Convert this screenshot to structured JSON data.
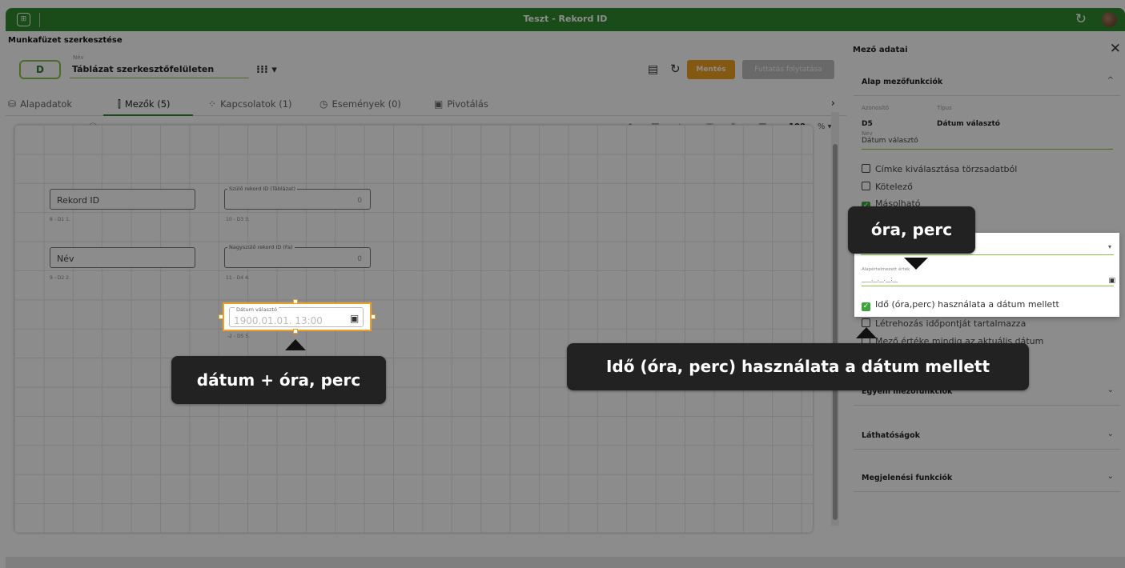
{
  "window": {
    "title": "Teszt - Rekord ID"
  },
  "header": {
    "page_title": "Munkafüzet szerkesztése",
    "badge": "D",
    "name_label": "Név",
    "name_value": "Táblázat szerkesztőfelületen",
    "save_label": "Mentés",
    "run_label": "Futtatás folytatása"
  },
  "tabs": [
    {
      "label": "Alapadatok",
      "icon": "database-icon"
    },
    {
      "label": "Mezők (5)",
      "icon": "fields-icon"
    },
    {
      "label": "Kapcsolatok (1)",
      "icon": "relations-icon"
    },
    {
      "label": "Események (0)",
      "icon": "events-icon"
    },
    {
      "label": "Pivotálás",
      "icon": "pivot-icon"
    }
  ],
  "toolbar": {
    "zoom": "100",
    "zoom_unit": "% ▾"
  },
  "canvas": {
    "fields": [
      {
        "value": "Rekord ID",
        "code": "8 - D1  1."
      },
      {
        "label": "Szülő rekord ID (Táblázat)",
        "value": "0",
        "code": "10 - D3  3."
      },
      {
        "value": "Név",
        "code": "9 - D2  2."
      },
      {
        "label": "Nagyszülő rekord ID (Fa)",
        "value": "0",
        "code": "11 - D4  4."
      }
    ],
    "date_field": {
      "label": "Dátum választó",
      "value": "1900.01.01. 13:00",
      "code": "-2 - D5  5."
    }
  },
  "panel": {
    "title": "Mező adatai",
    "section_basic": "Alap mezőfunkciók",
    "id_label": "Azonosító",
    "type_label": "Típus",
    "id_value": "D5",
    "type_value": "Dátum választó",
    "name_label": "Név",
    "name_value": "Dátum választó",
    "checkboxes": [
      {
        "label": "Címke kiválasztása törzsadatból",
        "checked": false
      },
      {
        "label": "Kötelező",
        "checked": false
      },
      {
        "label": "Másolható",
        "checked": true
      },
      {
        "label": "Létrehozás időpontját tartalmazza",
        "checked": false
      },
      {
        "label": "Mező értéke mindig az aktuális dátum",
        "checked": false
      }
    ],
    "popup": {
      "default_label": "Alapértelmezett érték",
      "default_value": "____.__.__. __:__",
      "time_checkbox": "Idő (óra,perc) használata a dátum mellett"
    },
    "sections": [
      "Egyéni mezőfunkciók",
      "Láthatóságok",
      "Megjelenési funkciók"
    ]
  },
  "callouts": {
    "c1": "dátum + óra, perc",
    "c2": "óra, perc",
    "c3": "Idő (óra, perc) használata a dátum mellett"
  }
}
